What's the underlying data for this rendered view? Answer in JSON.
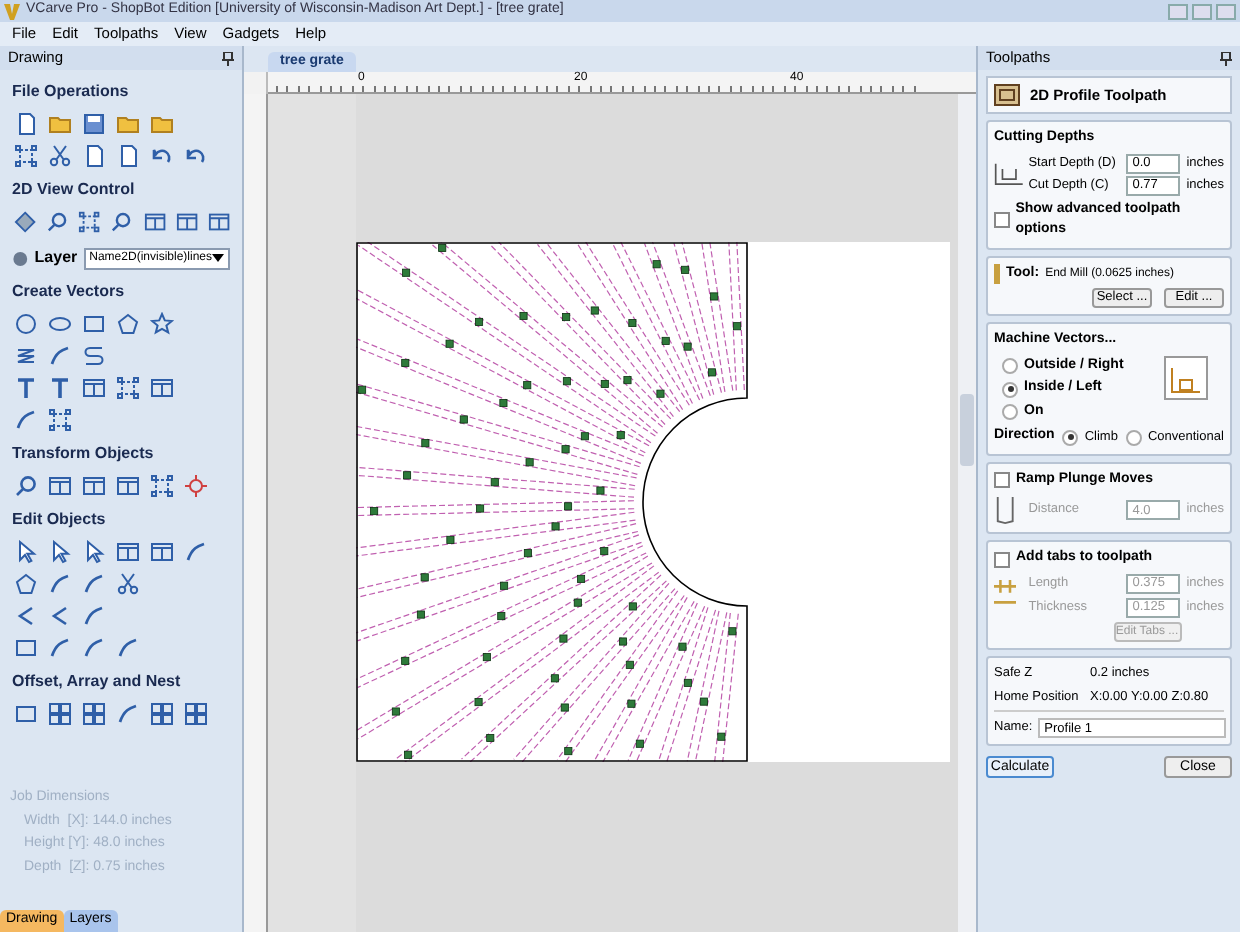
{
  "window": {
    "title": "VCarve Pro - ShopBot Edition [University of Wisconsin-Madison Art Dept.] - [tree grate]"
  },
  "menu": [
    "File",
    "Edit",
    "Toolpaths",
    "View",
    "Gadgets",
    "Help"
  ],
  "left_panel": {
    "title": "Drawing",
    "sections": [
      {
        "title": "File Operations"
      },
      {
        "title": "2D View Control"
      },
      {
        "title": "Create Vectors"
      },
      {
        "title": "Transform Objects"
      },
      {
        "title": "Edit Objects"
      },
      {
        "title": "Offset, Array and Nest"
      }
    ],
    "layer": {
      "label": "Layer",
      "value": "Name2D(invisible)lines"
    },
    "job_dimensions": {
      "title": "Job Dimensions",
      "lines": [
        "Width  [X]: 144.0 inches",
        "Height [Y]: 48.0 inches",
        "Depth  [Z]: 0.75 inches"
      ]
    },
    "bottom_tabs": [
      {
        "label": "Drawing",
        "selected": true
      },
      {
        "label": "Layers",
        "selected": false
      }
    ]
  },
  "document_tab": {
    "label": "tree grate"
  },
  "ruler": {
    "top_labels": [
      "0",
      "20",
      "40"
    ]
  },
  "toolpaths": {
    "title": "Toolpaths",
    "heading": "2D Profile Toolpath",
    "cutting_depths": {
      "title": "Cutting Depths",
      "fields": [
        {
          "label": "Start Depth (D)",
          "value": "0.0",
          "unit": "inches"
        },
        {
          "label": "Cut Depth (C)",
          "value": "0.77",
          "unit": "inches"
        }
      ]
    },
    "advanced": {
      "label": "Show advanced toolpath options",
      "checked": false
    },
    "tool": {
      "label": "Tool:",
      "value": "End Mill (0.0625 inches)",
      "buttons": [
        "Select ...",
        "Edit ..."
      ]
    },
    "machine_vectors": {
      "title": "Machine Vectors...",
      "options": [
        {
          "label": "Outside / Right",
          "selected": false
        },
        {
          "label": "Inside / Left",
          "selected": true
        },
        {
          "label": "On",
          "selected": false
        }
      ],
      "direction": {
        "label": "Direction",
        "options": [
          {
            "label": "Climb",
            "selected": true
          },
          {
            "label": "Conventional",
            "selected": false
          }
        ]
      }
    },
    "ramp": {
      "label": "Ramp Plunge Moves",
      "checked": false,
      "field": {
        "label": "Distance",
        "value": "4.0",
        "unit": "inches"
      }
    },
    "tabs": {
      "label": "Add tabs to toolpath",
      "checked": false,
      "fields": [
        {
          "label": "Length",
          "value": "0.375",
          "unit": "inches"
        },
        {
          "label": "Thickness",
          "value": "0.125",
          "unit": "inches"
        }
      ],
      "button": "Edit Tabs ..."
    },
    "info": [
      {
        "label": "Safe Z",
        "value": "0.2 inches"
      },
      {
        "label": "Home Position",
        "value": "X:0.00 Y:0.00 Z:0.80"
      }
    ],
    "name": {
      "label": "Name:",
      "value": "Profile 1"
    },
    "buttons": [
      "Calculate",
      "Close"
    ]
  }
}
